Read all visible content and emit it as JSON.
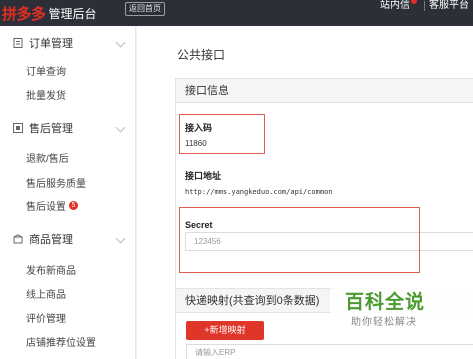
{
  "topbar": {
    "brand": "拼多多",
    "title": "管理后台",
    "back_home": "返回首页",
    "links": {
      "inbox": "站内信",
      "service": "客服平台"
    }
  },
  "sidebar": {
    "sections": [
      {
        "label": "订单管理",
        "icon": "document-icon",
        "items": [
          "订单查询",
          "批量发货"
        ]
      },
      {
        "label": "售后管理",
        "icon": "after-sale-icon",
        "items": [
          "退款/售后",
          "售后服务质量",
          "售后设置"
        ],
        "badge": "5"
      },
      {
        "label": "商品管理",
        "icon": "product-icon",
        "items": [
          "发布新商品",
          "线上商品",
          "评价管理",
          "店铺推荐位设置"
        ]
      }
    ]
  },
  "main": {
    "page_title": "公共接口",
    "panel_title": "接口信息",
    "access_code_label": "接入码",
    "access_code_value": "11860",
    "url_label": "接口地址",
    "url_value": "http://mms.yangkeduo.com/api/common",
    "secret_label": "Secret",
    "secret_placeholder": "123456",
    "mapping_title": "快递映射(共查询到0条数据)",
    "add_mapping_button": "+新增映射",
    "erp_placeholder": "请输入ERP"
  },
  "watermark": {
    "big": "百科全说",
    "small": "助你轻松解决"
  },
  "colors": {
    "topbar_bg": "#2d2f38",
    "brand_red": "#e02e24",
    "button_red": "#e0362a",
    "highlight_box": "#e05a4f",
    "watermark_green": "#4a9a2e"
  }
}
